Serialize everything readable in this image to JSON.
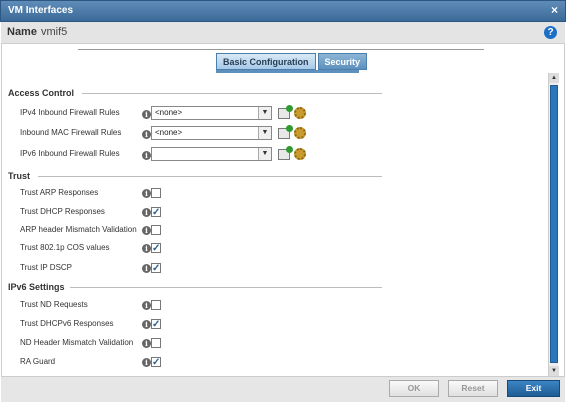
{
  "window": {
    "title": "VM Interfaces",
    "close_glyph": "×"
  },
  "header": {
    "name_label": "Name",
    "name_value": "vmif5",
    "help_glyph": "?"
  },
  "tabs": [
    {
      "label": "Basic Configuration",
      "active": true
    },
    {
      "label": "Security",
      "active": false
    }
  ],
  "access_control": {
    "title": "Access Control",
    "rows": [
      {
        "label": "IPv4 Inbound Firewall Rules",
        "value": "<none>"
      },
      {
        "label": "Inbound MAC Firewall Rules",
        "value": "<none>"
      },
      {
        "label": "IPv6 Inbound Firewall Rules",
        "value": ""
      }
    ]
  },
  "trust": {
    "title": "Trust",
    "rows": [
      {
        "label": "Trust ARP Responses",
        "checked": false
      },
      {
        "label": "Trust DHCP Responses",
        "checked": true
      },
      {
        "label": "ARP header Mismatch Validation",
        "checked": false
      },
      {
        "label": "Trust 802.1p COS values",
        "checked": true
      },
      {
        "label": "Trust IP DSCP",
        "checked": true
      }
    ]
  },
  "ipv6": {
    "title": "IPv6 Settings",
    "rows": [
      {
        "label": "Trust ND Requests",
        "checked": false
      },
      {
        "label": "Trust DHCPv6 Responses",
        "checked": true
      },
      {
        "label": "ND Header Mismatch Validation",
        "checked": false
      },
      {
        "label": "RA Guard",
        "checked": true
      }
    ]
  },
  "footer": {
    "ok": "OK",
    "reset": "Reset",
    "exit": "Exit"
  },
  "glyphs": {
    "info": "i",
    "check": "✓",
    "dropdown": "▼",
    "scroll_up": "▲",
    "scroll_down": "▼"
  },
  "icons": {
    "add": "add-rule-icon",
    "config": "gear-icon"
  },
  "colors": {
    "accent": "#2b77bb",
    "titlebar": "#3c6a98",
    "check": "#2a5f8e"
  }
}
